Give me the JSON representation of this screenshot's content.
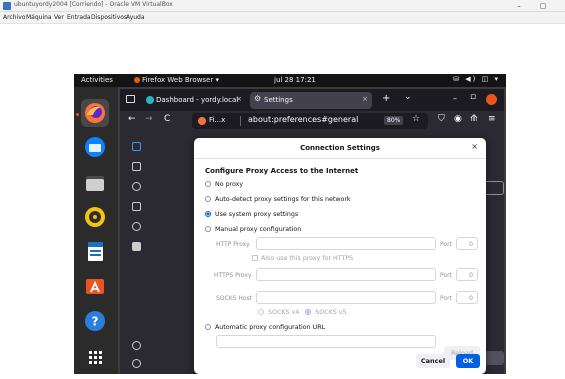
{
  "host": {
    "window_title": "ubuntuyordy2004 [Corriendo] - Oracle VM VirtualBox",
    "menu": [
      "Archivo",
      "Máquina",
      "Ver",
      "Entrada",
      "Dispositivos",
      "Ayuda"
    ],
    "controls": {
      "minimize": "–",
      "maximize": "▢"
    }
  },
  "guest": {
    "topbar": {
      "activities": "Activities",
      "app_menu": "Firefox Web Browser ▾",
      "clock": "jul 28  17:21",
      "tray": "⛁ ◀) ◫ ▾"
    },
    "firefox": {
      "tabs": [
        {
          "label": "Dashboard - yordy.local",
          "close": "×"
        },
        {
          "label": "Settings",
          "close": "×"
        }
      ],
      "tab_controls": {
        "new_tab": "+",
        "list_tabs": "⌄",
        "minimize": "–",
        "maximize": "▫"
      },
      "nav": {
        "back": "←",
        "forward": "→",
        "reload": "C",
        "identity_label": "Fi...x",
        "url": "about:preferences#general",
        "zoom": "80%",
        "bookmark_star": "☆",
        "pocket": "⛉",
        "account": "◉",
        "extensions": "⟰",
        "menu": "≡"
      }
    },
    "dialog": {
      "title": "Connection Settings",
      "close": "×",
      "heading": "Configure Proxy Access to the Internet",
      "options": [
        {
          "label": "No proxy",
          "selected": false
        },
        {
          "label": "Auto-detect proxy settings for this network",
          "selected": false
        },
        {
          "label": "Use system proxy settings",
          "selected": true
        },
        {
          "label": "Manual proxy configuration",
          "selected": false
        }
      ],
      "http_proxy_label": "HTTP Proxy",
      "also_https_label": "Also use this proxy for HTTPS",
      "https_proxy_label": "HTTPS Proxy",
      "socks_host_label": "SOCKS Host",
      "port_label": "Port",
      "port_value": "0",
      "socks_v4_label": "SOCKS v4",
      "socks_v5_label": "SOCKS v5",
      "auto_config_label": "Automatic proxy configuration URL",
      "reload_label": "Reload",
      "cancel_label": "Cancel",
      "ok_label": "OK"
    }
  },
  "colors": {
    "accent": "#0061e0",
    "ubuntu_orange": "#e95420",
    "guest_bg": "#3f3a3d",
    "firefox_dark": "#2b2a33"
  }
}
